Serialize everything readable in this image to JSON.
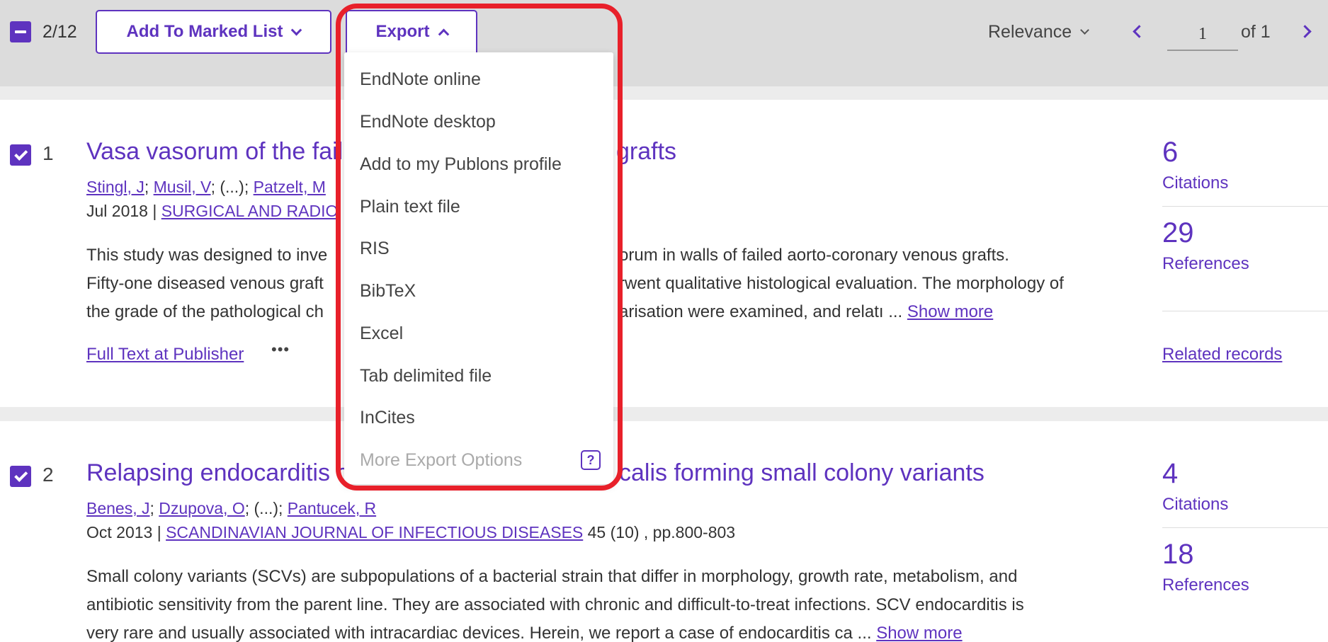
{
  "toolbar": {
    "selected_count": "2/12",
    "add_to_marked_list": "Add To Marked List",
    "export": "Export",
    "sort": "Relevance",
    "page_current": "1",
    "page_of": "of 1"
  },
  "export_menu": {
    "items": [
      "EndNote online",
      "EndNote desktop",
      "Add to my Publons profile",
      "Plain text file",
      "RIS",
      "BibTeX",
      "Excel",
      "Tab delimited file",
      "InCites"
    ],
    "more_options": "More Export Options",
    "help": "?"
  },
  "records": [
    {
      "number": "1",
      "title_start": "Vasa vasorum of the fail",
      "title_end": "grafts",
      "authors": [
        "Stingl, J",
        "Musil, V",
        "Patzelt, M"
      ],
      "authors_sep": "; (...); ",
      "date": "Jul 2018 | ",
      "journal": "SURGICAL AND RADIO",
      "abstract_lines": [
        [
          "This study was designed to inve",
          "orum in walls of failed aorto-coronary venous grafts."
        ],
        [
          "Fifty-one diseased venous graft",
          "rwent qualitative histological evaluation. The morphology of"
        ],
        [
          "the grade of the pathological ch",
          "arisation were examined, and relatı ... "
        ]
      ],
      "show_more": "Show more",
      "full_text": "Full Text at Publisher",
      "more": "•••",
      "citations": "6",
      "citations_label": "Citations",
      "references": "29",
      "references_label": "References",
      "related": "Related records"
    },
    {
      "number": "2",
      "title_start": "Relapsing endocarditis c",
      "title_end": "calis forming small colony variants",
      "authors": [
        "Benes, J",
        "Dzupova, O",
        "Pantucek, R"
      ],
      "authors_sep": "; (...); ",
      "date": "Oct 2013 | ",
      "journal": "SCANDINAVIAN JOURNAL OF INFECTIOUS DISEASES",
      "volume": " 45 (10) , pp.800-803",
      "abstract_lines": [
        "Small colony variants (SCVs) are subpopulations of a bacterial strain that differ in morphology, growth rate, metabolism, and",
        "antibiotic sensitivity from the parent line. They are associated with chronic and difficult-to-treat infections. SCV endocarditis is",
        "very rare and usually associated with intracardiac devices. Herein, we report a case of endocarditis ca ... "
      ],
      "show_more": "Show more",
      "citations": "4",
      "citations_label": "Citations",
      "references": "18",
      "references_label": "References"
    }
  ],
  "colors": {
    "accent": "#5e33bf",
    "highlight": "#e8202a",
    "toolbar_bg": "#dcdcdc"
  }
}
